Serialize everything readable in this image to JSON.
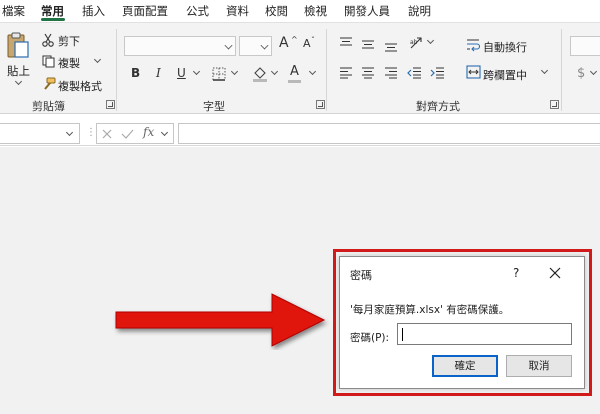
{
  "menu": {
    "tabs": [
      "檔案",
      "常用",
      "插入",
      "頁面配置",
      "公式",
      "資料",
      "校閱",
      "檢視",
      "開發人員",
      "說明"
    ]
  },
  "ribbon": {
    "clipboard": {
      "paste": "貼上",
      "cut": "剪下",
      "copy": "複製",
      "format_painter": "複製格式",
      "group": "剪貼簿"
    },
    "font": {
      "bold": "B",
      "italic": "I",
      "underline": "U",
      "grow": "A",
      "shrink": "A",
      "font_color": "A",
      "group": "字型"
    },
    "alignment": {
      "wrap": "自動換行",
      "merge": "跨欄置中",
      "group": "對齊方式"
    },
    "number": {
      "currency": "$"
    }
  },
  "formula_bar": {
    "fx": "fx"
  },
  "dialog": {
    "title": "密碼",
    "help": "?",
    "message": "'每月家庭預算.xlsx' 有密碼保護。",
    "label": "密碼(P):",
    "password_value": "",
    "ok": "確定",
    "cancel": "取消"
  },
  "colors": {
    "accent_green": "#217346",
    "highlight_red": "#d11a1a",
    "arrow_red": "#e0120f",
    "primary_button_border": "#0a63c9"
  }
}
